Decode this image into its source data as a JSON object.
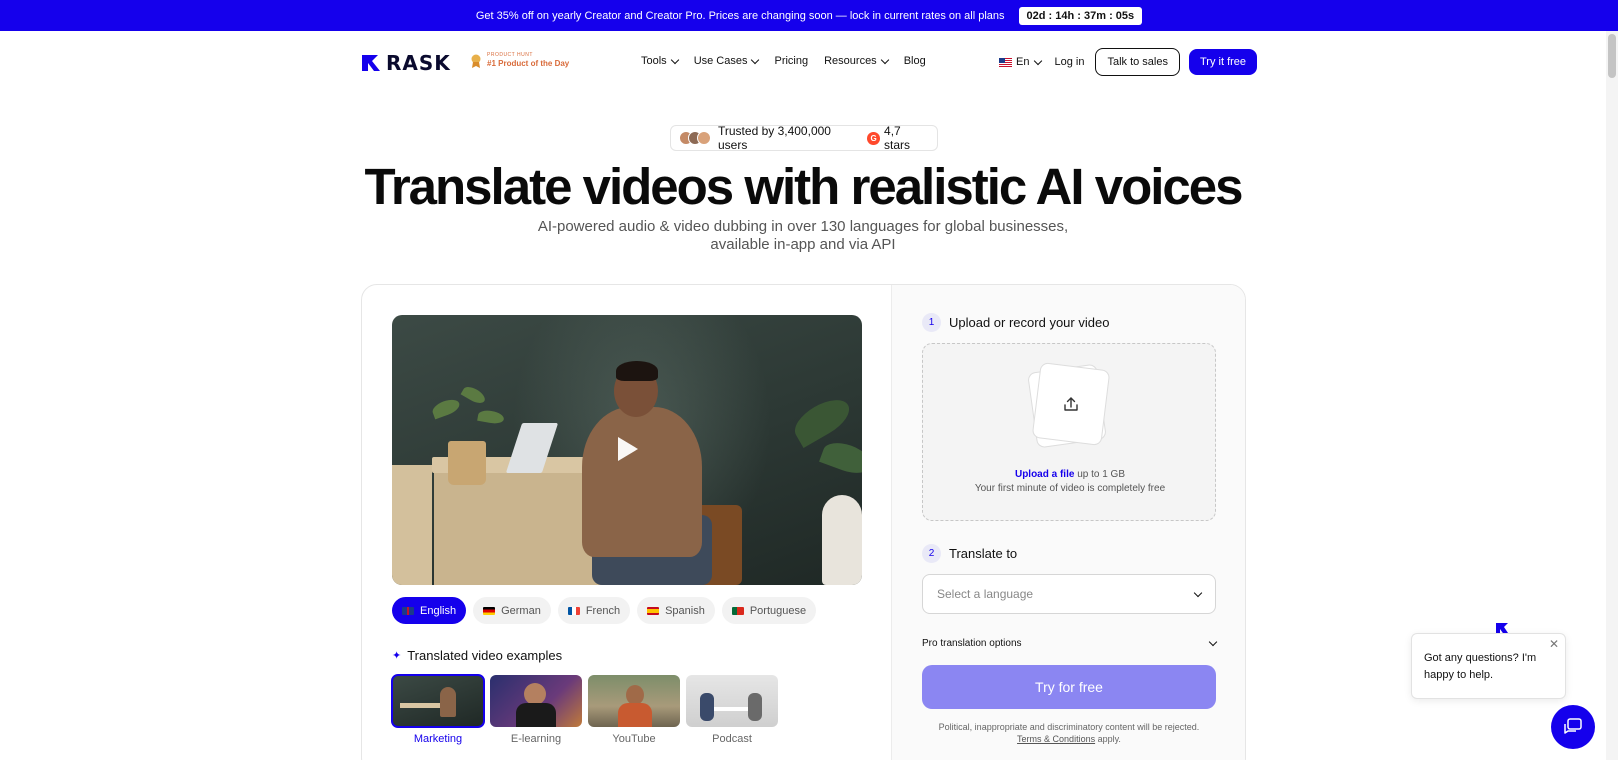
{
  "promo": {
    "text": "Get 35% off on yearly Creator and Creator Pro. Prices are changing soon — lock in current rates on all plans",
    "timer": "02d : 14h : 37m : 05s"
  },
  "nav": {
    "logo": "RASK",
    "badge_small": "PRODUCT HUNT",
    "badge_big": "#1 Product of the Day",
    "menu": [
      {
        "label": "Tools",
        "dropdown": true
      },
      {
        "label": "Use Cases",
        "dropdown": true
      },
      {
        "label": "Pricing",
        "dropdown": false
      },
      {
        "label": "Resources",
        "dropdown": true
      },
      {
        "label": "Blog",
        "dropdown": false
      }
    ],
    "language": "En",
    "login": "Log in",
    "talk_sales": "Talk to sales",
    "try_free": "Try it free"
  },
  "hero": {
    "trust_users": "Trusted by 3,400,000 users",
    "trust_stars": "4,7 stars",
    "title": "Translate videos with realistic AI voices",
    "subtitle_line1": "AI-powered audio & video dubbing in over 130 languages for global businesses,",
    "subtitle_line2": "available in-app and via API"
  },
  "demo": {
    "languages": [
      {
        "label": "English",
        "active": true
      },
      {
        "label": "German",
        "active": false
      },
      {
        "label": "French",
        "active": false
      },
      {
        "label": "Spanish",
        "active": false
      },
      {
        "label": "Portuguese",
        "active": false
      }
    ],
    "examples_title": "Translated video examples",
    "examples": [
      {
        "label": "Marketing",
        "active": true
      },
      {
        "label": "E-learning",
        "active": false
      },
      {
        "label": "YouTube",
        "active": false
      },
      {
        "label": "Podcast",
        "active": false
      }
    ]
  },
  "form": {
    "step1_num": "1",
    "step1_title": "Upload or record your video",
    "upload_link": "Upload a file",
    "upload_limit": " up to 1 GB",
    "upload_note": "Your first minute of video is completely free",
    "step2_num": "2",
    "step2_title": "Translate to",
    "select_placeholder": "Select a language",
    "pro_options": "Pro translation options",
    "try_button": "Try for free",
    "disclaimer_line1": "Political, inappropriate and discriminatory content will be rejected.",
    "terms": "Terms & Conditions",
    "terms_suffix": " apply."
  },
  "chat": {
    "message": "Got any questions? I'm happy to help.",
    "close": "✕"
  },
  "colors": {
    "brand": "#1500ec",
    "button_disabled": "#8b86f2"
  }
}
